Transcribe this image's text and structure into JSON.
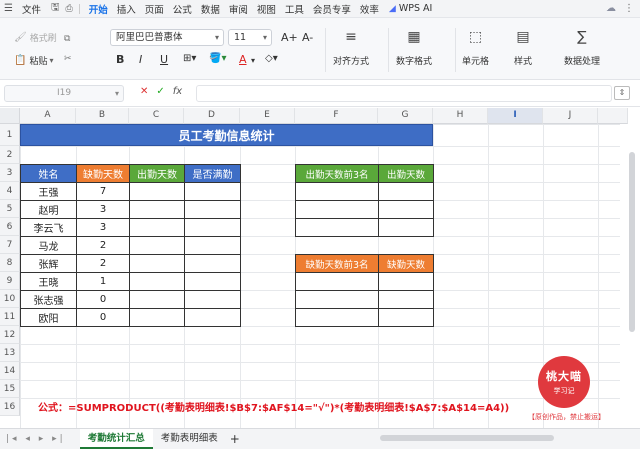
{
  "menubar": {
    "file_label": "文件",
    "tabs": [
      "开始",
      "插入",
      "页面",
      "公式",
      "数据",
      "审阅",
      "视图",
      "工具",
      "会员专享",
      "效率"
    ],
    "active_tab": "开始",
    "wps_ai_label": "WPS AI"
  },
  "ribbon": {
    "format_painter": "格式刷",
    "paste": "粘贴",
    "font_name": "阿里巴巴普惠体",
    "font_size": "11",
    "align_label": "对齐方式",
    "number_format_label": "数字格式",
    "cell_label": "单元格",
    "style_label": "样式",
    "data_process_label": "数据处理",
    "bold": "B",
    "italic": "I",
    "underline": "U",
    "grow_font": "A+",
    "shrink_font": "A-"
  },
  "formula_bar": {
    "name_box": "I19",
    "fx_label": "fx",
    "formula": ""
  },
  "grid": {
    "columns": [
      "A",
      "B",
      "C",
      "D",
      "E",
      "F",
      "G",
      "H",
      "I",
      "J"
    ],
    "rows": [
      "1",
      "2",
      "3",
      "4",
      "5",
      "6",
      "7",
      "8",
      "9",
      "10",
      "11",
      "12",
      "13",
      "14",
      "15",
      "16"
    ],
    "selected_column": "I",
    "title": "员工考勤信息统计",
    "headers": {
      "name": "姓名",
      "absent_days": "缺勤天数",
      "attend_days": "出勤天数",
      "full_attend": "是否满勤",
      "top3_attend": "出勤天数前3名",
      "attend_days2": "出勤天数",
      "top3_absent": "缺勤天数前3名",
      "absent_days2": "缺勤天数"
    },
    "employees": [
      {
        "name": "王强",
        "absent": "7"
      },
      {
        "name": "赵明",
        "absent": "3"
      },
      {
        "name": "李云飞",
        "absent": "3"
      },
      {
        "name": "马龙",
        "absent": "2"
      },
      {
        "name": "张辉",
        "absent": "2"
      },
      {
        "name": "王晓",
        "absent": "1"
      },
      {
        "name": "张志强",
        "absent": "0"
      },
      {
        "name": "欧阳",
        "absent": "0"
      }
    ]
  },
  "caption": "公式：=SUMPRODUCT((考勤表明细表!$B$7:$AF$14=\"√\")*(考勤表明细表!$A$7:$A$14=A4))",
  "stamp": {
    "title": "桃大喵",
    "subtitle": "学习记",
    "note": "【原创作品，禁止搬运】"
  },
  "sheets": {
    "tabs": [
      "考勤统计汇总",
      "考勤表明细表"
    ],
    "active": "考勤统计汇总",
    "add_label": "+"
  },
  "colors": {
    "title_blue": "#3e6dc5",
    "header_orange": "#ee7d31",
    "header_green": "#5aa83a",
    "formula_red": "#e0141e",
    "active_tab_green": "#1f7a36"
  }
}
